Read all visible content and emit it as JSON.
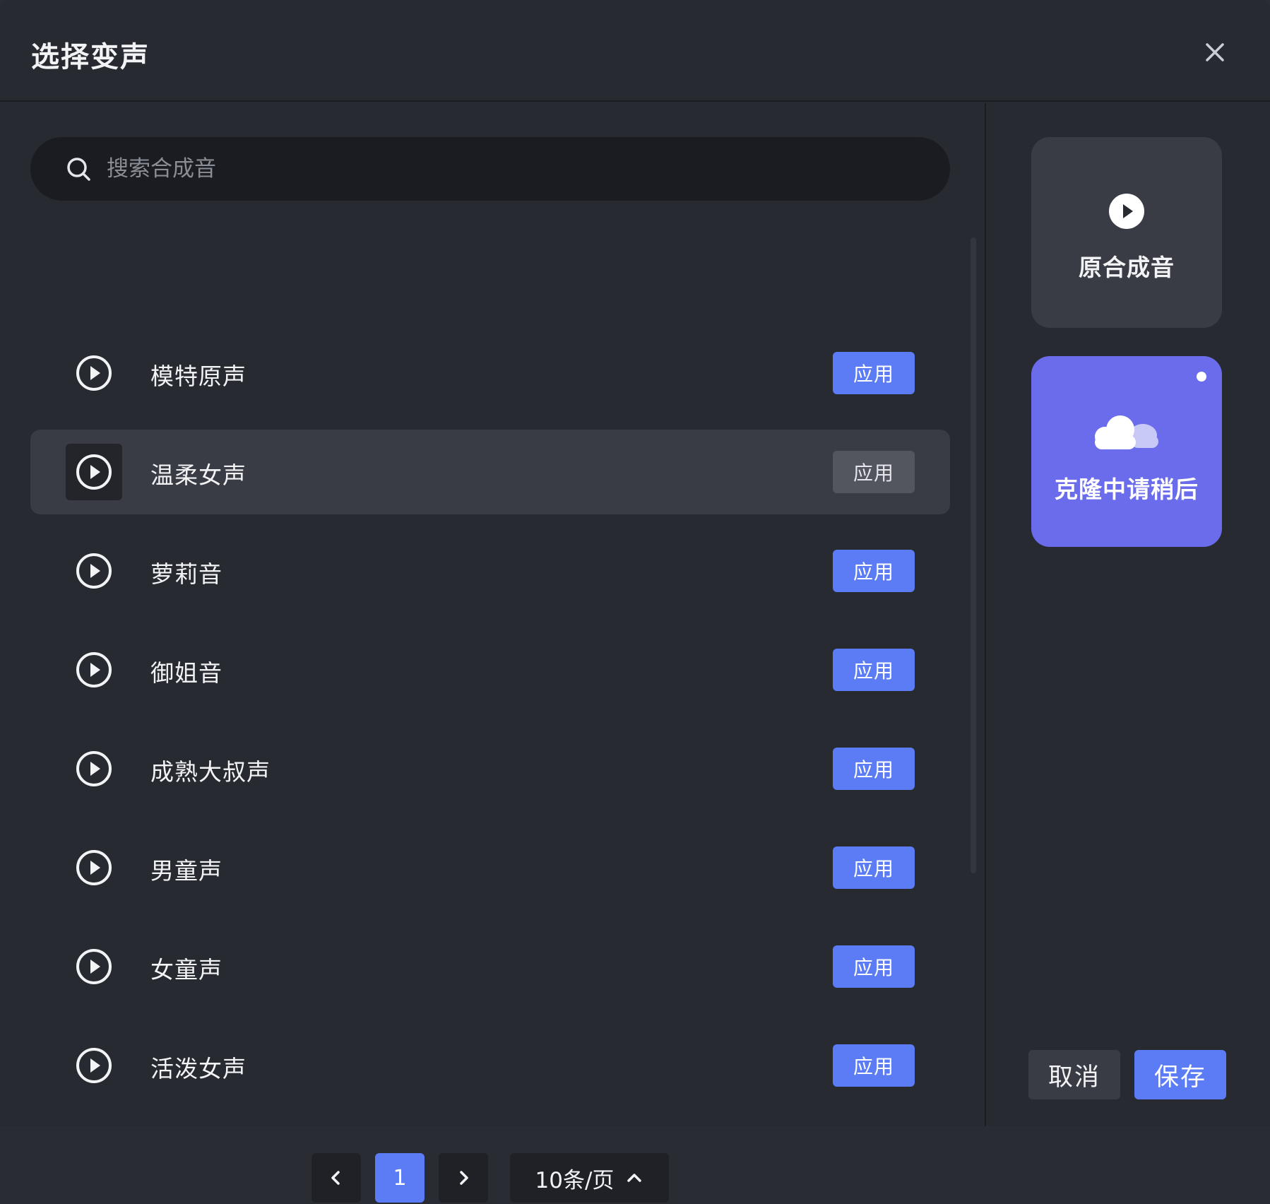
{
  "dialog": {
    "title": "选择变声"
  },
  "search": {
    "placeholder": "搜索合成音"
  },
  "voices": [
    {
      "name": "模特原声",
      "apply_label": "应用"
    },
    {
      "name": "温柔女声",
      "apply_label": "应用"
    },
    {
      "name": "萝莉音",
      "apply_label": "应用"
    },
    {
      "name": "御姐音",
      "apply_label": "应用"
    },
    {
      "name": "成熟大叔声",
      "apply_label": "应用"
    },
    {
      "name": "男童声",
      "apply_label": "应用"
    },
    {
      "name": "女童声",
      "apply_label": "应用"
    },
    {
      "name": "活泼女声",
      "apply_label": "应用"
    }
  ],
  "pagination": {
    "current_page": "1",
    "page_size": "10条/页"
  },
  "side_cards": {
    "original_label": "原合成音",
    "cloning_label": "克隆中请稍后"
  },
  "footer": {
    "cancel_label": "取消",
    "save_label": "保存"
  },
  "colors": {
    "accent": "#5b7cf5",
    "clone_card": "#6b6ceb",
    "background": "#272a31"
  }
}
